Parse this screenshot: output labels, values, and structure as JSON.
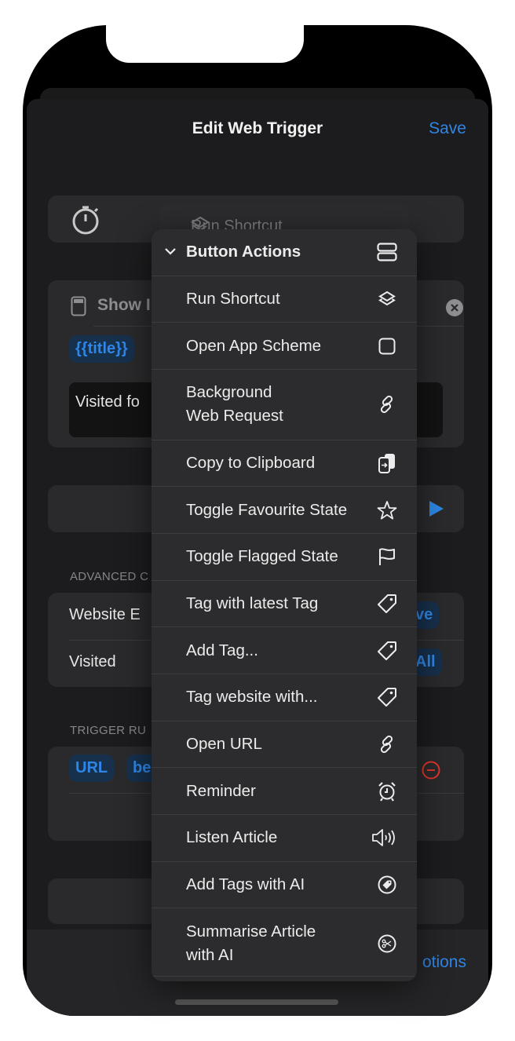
{
  "nav": {
    "title": "Edit Web Trigger",
    "save_label": "Save"
  },
  "background": {
    "timer_row": {
      "icon": "stopwatch-icon"
    },
    "ghost_action": {
      "label": "Run Shortcut",
      "icon": "layers-icon"
    },
    "show_card": {
      "label": "Show I",
      "icon": "display-icon",
      "clear_icon": "xmark-circle-icon",
      "chip": "{{title}}",
      "text_value": "Visited fo"
    },
    "run_row": {
      "icon": "play-icon"
    },
    "advanced": {
      "header": "ADVANCED C",
      "rows": [
        {
          "label": "Website E",
          "chip": "ve"
        },
        {
          "label": "Visited",
          "chip": "All"
        }
      ]
    },
    "trigger_rules": {
      "header": "TRIGGER RU",
      "chips": [
        "URL",
        "be"
      ],
      "remove_icon": "minus-circle-icon"
    },
    "toolbar": {
      "options_label": "otions"
    }
  },
  "menu": {
    "header": {
      "label": "Button Actions",
      "icon": "rectangle-split-icon",
      "chevron": "chevron-down-icon"
    },
    "items": [
      {
        "label": "Run Shortcut",
        "icon": "layers-icon"
      },
      {
        "label": "Open App Scheme",
        "icon": "square-icon"
      },
      {
        "label": "Background Web Request",
        "line1": "Background",
        "line2": "Web Request",
        "icon": "link-icon"
      },
      {
        "label": "Copy to Clipboard",
        "icon": "doc-on-clipboard-icon"
      },
      {
        "label": "Toggle Favourite State",
        "icon": "star-icon"
      },
      {
        "label": "Toggle Flagged State",
        "icon": "flag-icon"
      },
      {
        "label": "Tag with latest Tag",
        "icon": "tag-icon"
      },
      {
        "label": "Add Tag...",
        "icon": "tag-icon"
      },
      {
        "label": "Tag website with...",
        "icon": "tag-icon"
      },
      {
        "label": "Open URL",
        "icon": "link-icon"
      },
      {
        "label": "Reminder",
        "icon": "alarm-icon"
      },
      {
        "label": "Listen Article",
        "icon": "speaker-wave-icon"
      },
      {
        "label": "Add Tags with AI",
        "icon": "tag-circle-icon"
      },
      {
        "label": "Summarise Article with AI",
        "line1": "Summarise Article",
        "line2": "with AI",
        "icon": "scissors-circle-icon"
      }
    ]
  },
  "colors": {
    "accent": "#2e86e6",
    "destructive": "#e0352b",
    "menu_bg": "#2c2c2e",
    "sheet_bg": "#1c1c1e"
  }
}
